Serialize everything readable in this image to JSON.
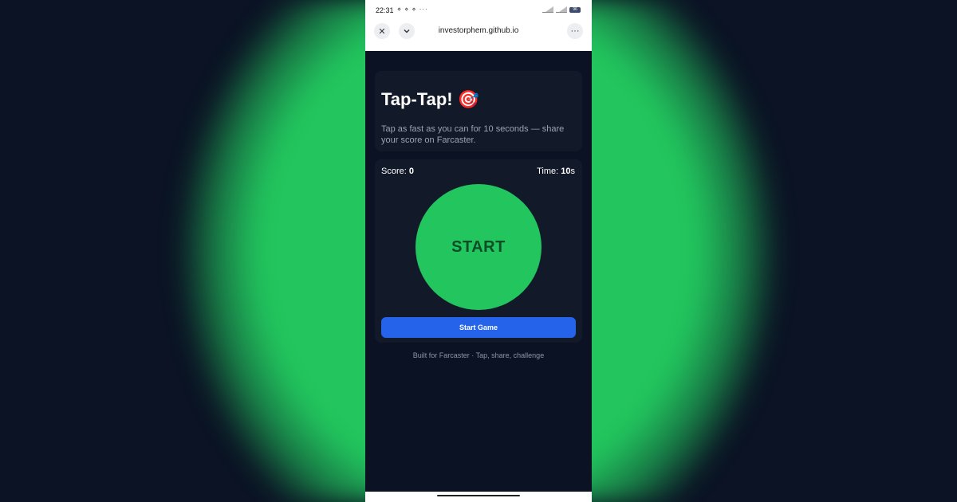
{
  "status_bar": {
    "time": "22:31",
    "left_icons": "⋄ ⋄ ⋄ ···",
    "battery": "96"
  },
  "browser": {
    "url": "investorphem.github.io",
    "close_icon": "close-icon",
    "chevron_icon": "chevron-down-icon",
    "more_icon": "more-icon"
  },
  "header": {
    "title": "Tap-Tap! 🎯",
    "description": "Tap as fast as you can for 10 seconds — share your score on Farcaster."
  },
  "game": {
    "score_label": "Score: ",
    "score_value": "0",
    "time_label": "Time: ",
    "time_value": "10",
    "time_unit": "s",
    "circle_label": "START",
    "start_button": "Start Game"
  },
  "footer": {
    "text": "Built for Farcaster · Tap, share, challenge"
  },
  "colors": {
    "accent_green": "#22c55e",
    "button_blue": "#2563eb",
    "background": "#0b1224"
  }
}
